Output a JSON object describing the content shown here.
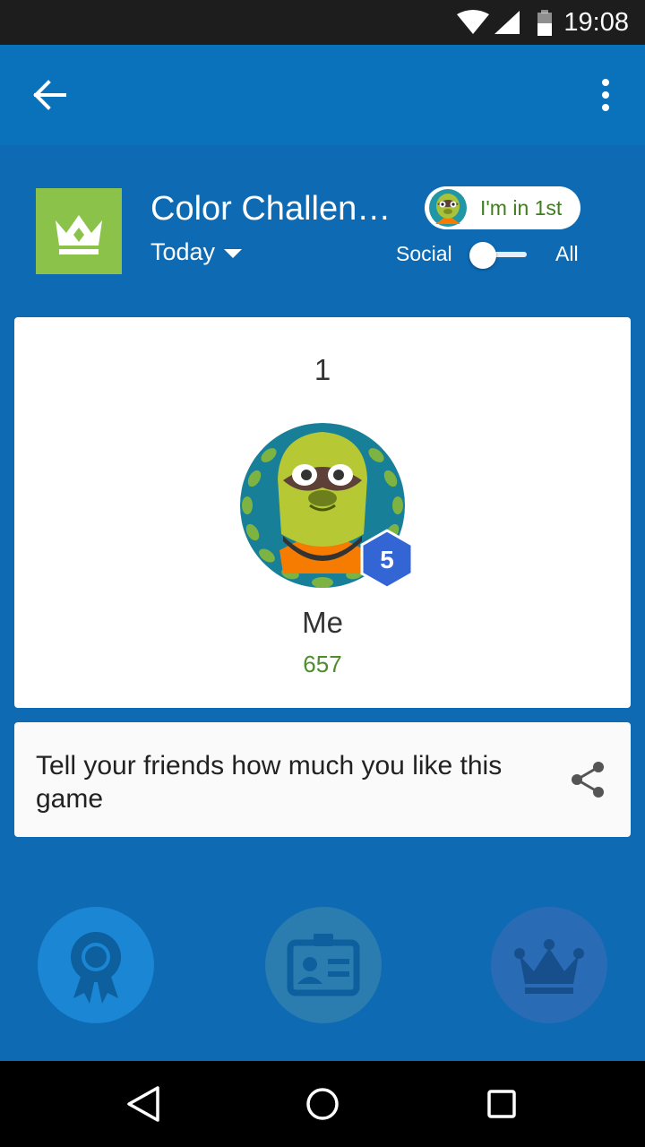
{
  "status_bar": {
    "time": "19:08"
  },
  "game": {
    "title": "Color Challen…",
    "period": "Today",
    "rank_chip": "I'm in 1st",
    "toggle_left": "Social",
    "toggle_right": "All"
  },
  "leaderboard": {
    "rank": "1",
    "player_name": "Me",
    "score": "657",
    "level": "5"
  },
  "share": {
    "text": "Tell your friends how much you like this game"
  },
  "icons": {
    "back": "arrow-back-icon",
    "more": "more-vert-icon",
    "share": "share-icon",
    "achievements": "ribbon-award-icon",
    "profile": "id-card-icon",
    "leaderboards": "crown-icon"
  },
  "colors": {
    "app_bar": "#0a72ba",
    "accent_green": "#8bc34a",
    "score_green": "#4e8d2b",
    "badge_blue": "#3465d4"
  }
}
